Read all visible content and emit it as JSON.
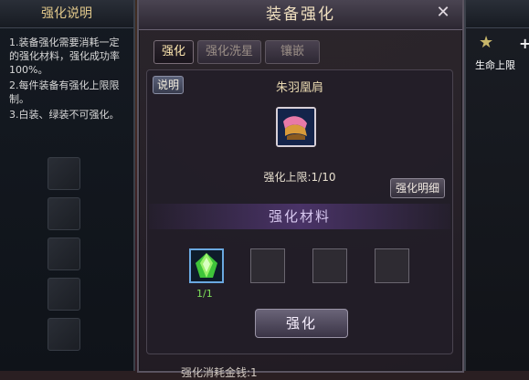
{
  "left_panel": {
    "title": "强化说明",
    "notes": [
      "1.装备强化需要消耗一定的强化材料，强化成功率100%。",
      "2.每件装备有强化上限限制。",
      "3.白装、绿装不可强化。"
    ]
  },
  "right_panel": {
    "life_limit_label": "生命上限",
    "plus": "+"
  },
  "main": {
    "title": "装备强化",
    "close": "✕",
    "tabs": [
      {
        "label": "强化",
        "active": true
      },
      {
        "label": "强化洗星",
        "active": false
      },
      {
        "label": "镶嵌",
        "active": false
      }
    ],
    "desc_button": "说明",
    "item_name": "朱羽凰肩",
    "limit_text": "强化上限:1/10",
    "detail_button": "强化明细",
    "materials_title": "强化材料",
    "material_count": "1/1",
    "enhance_button": "强化",
    "cost_text": "强化消耗金钱:1"
  },
  "colors": {
    "accent_gold": "#e0c78a",
    "material_green": "#7ee05a",
    "slot_blue": "#6aa8e0"
  }
}
